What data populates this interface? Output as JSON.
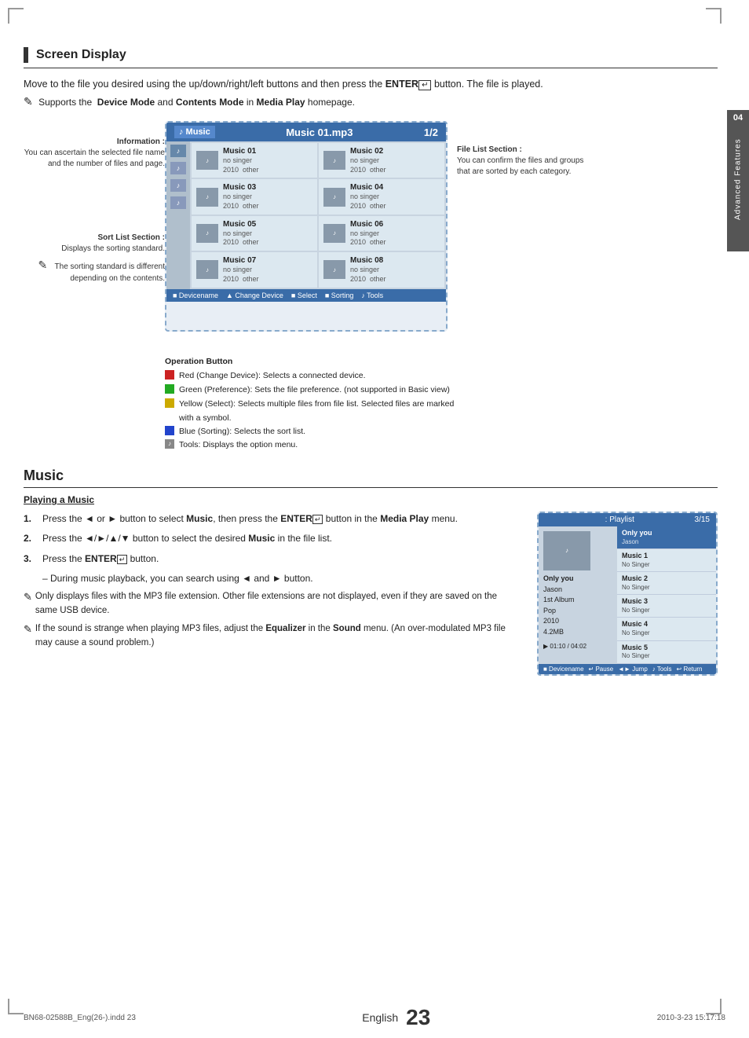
{
  "page": {
    "side_tab": {
      "number": "04",
      "label": "Advanced Features"
    },
    "page_number": "23",
    "language": "English",
    "footer_left": "BN68-02588B_Eng(26-).indd   23",
    "footer_right": "2010-3-23   15:17:18"
  },
  "screen_display": {
    "title": "Screen Display",
    "intro": "Move to the file you desired using the up/down/right/left buttons and then press the ENTER",
    "intro2": "button. The file is played.",
    "note": "Supports the  Device Mode and Contents Mode in Media Play homepage.",
    "left_annotations": {
      "information": {
        "title": "Information :",
        "text": "You can ascertain the selected file name and the number of files and page."
      },
      "sort_list": {
        "title": "Sort List Section :",
        "text": "Displays the sorting standard."
      },
      "sort_note": "The sorting standard is different depending on the contents."
    },
    "right_annotation": {
      "title": "File List Section :",
      "text": "You can confirm the files and groups that are sorted by each category."
    },
    "screen_mock": {
      "header": {
        "icon_label": "Music",
        "title": "Music 01.mp3",
        "page": "1/2"
      },
      "files": [
        {
          "name": "Music 01",
          "singer": "no singer",
          "year": "2010",
          "cat": "other"
        },
        {
          "name": "Music 02",
          "singer": "no singer",
          "year": "2010",
          "cat": "other"
        },
        {
          "name": "Music 03",
          "singer": "no singer",
          "year": "2010",
          "cat": "other"
        },
        {
          "name": "Music 04",
          "singer": "no singer",
          "year": "2010",
          "cat": "other"
        },
        {
          "name": "Music 05",
          "singer": "no singer",
          "year": "2010",
          "cat": "other"
        },
        {
          "name": "Music 06",
          "singer": "no singer",
          "year": "2010",
          "cat": "other"
        },
        {
          "name": "Music 07",
          "singer": "no singer",
          "year": "2010",
          "cat": "other"
        },
        {
          "name": "Music 08",
          "singer": "no singer",
          "year": "2010",
          "cat": "other"
        }
      ],
      "footer_items": [
        "Devicename",
        "▲ Change Device",
        "■ Select",
        "■ Sorting",
        "Tools"
      ]
    },
    "operation_button": {
      "title": "Operation Button",
      "items": [
        {
          "color": "red",
          "text": "Red (Change Device): Selects a connected device."
        },
        {
          "color": "green",
          "text": "Green (Preference): Sets the file preference. (not supported in Basic view)"
        },
        {
          "color": "yellow",
          "text": "Yellow (Select): Selects multiple files from file list. Selected files are marked with a symbol."
        },
        {
          "color": "blue",
          "text": "Blue (Sorting): Selects the sort list."
        },
        {
          "color": "tools",
          "text": "Tools: Displays the option menu."
        }
      ]
    }
  },
  "music": {
    "title": "Music",
    "subtitle": "Playing a Music",
    "steps": [
      {
        "num": "1.",
        "text": "Press the ◄ or ► button to select Music, then press the ENTER button in the Media Play menu."
      },
      {
        "num": "2.",
        "text": "Press the ◄/►/▲/▼ button to select the desired Music in the file list."
      },
      {
        "num": "3.",
        "text": "Press the ENTER button.",
        "sub": "– During music playback, you can search using ◄ and ► button."
      }
    ],
    "notes": [
      "Only displays files with the MP3 file extension. Other file extensions are not displayed, even if they are saved on the same USB device.",
      "If the sound is strange when playing MP3 files, adjust the Equalizer in the Sound menu. (An over-modulated MP3 file may cause a sound problem.)"
    ],
    "playback_screen": {
      "header": {
        "playlist_label": "Playlist",
        "page": "3/15"
      },
      "track_info": {
        "title": "Only you",
        "artist": "Jason",
        "album": "1st Album",
        "genre": "Pop",
        "year": "2010",
        "size": "4.2MB"
      },
      "time": "01:10 / 04:02",
      "playlist": [
        {
          "name": "Only you",
          "singer": "Jason",
          "active": true
        },
        {
          "name": "Music 1",
          "singer": "No Singer",
          "active": false
        },
        {
          "name": "Music 2",
          "singer": "No Singer",
          "active": false
        },
        {
          "name": "Music 3",
          "singer": "No Singer",
          "active": false
        },
        {
          "name": "Music 4",
          "singer": "No Singer",
          "active": false
        },
        {
          "name": "Music 5",
          "singer": "No Singer",
          "active": false
        }
      ],
      "footer_items": [
        "Devicename",
        "Pause",
        "◄► Jump",
        "Tools",
        "↩ Return"
      ]
    }
  }
}
